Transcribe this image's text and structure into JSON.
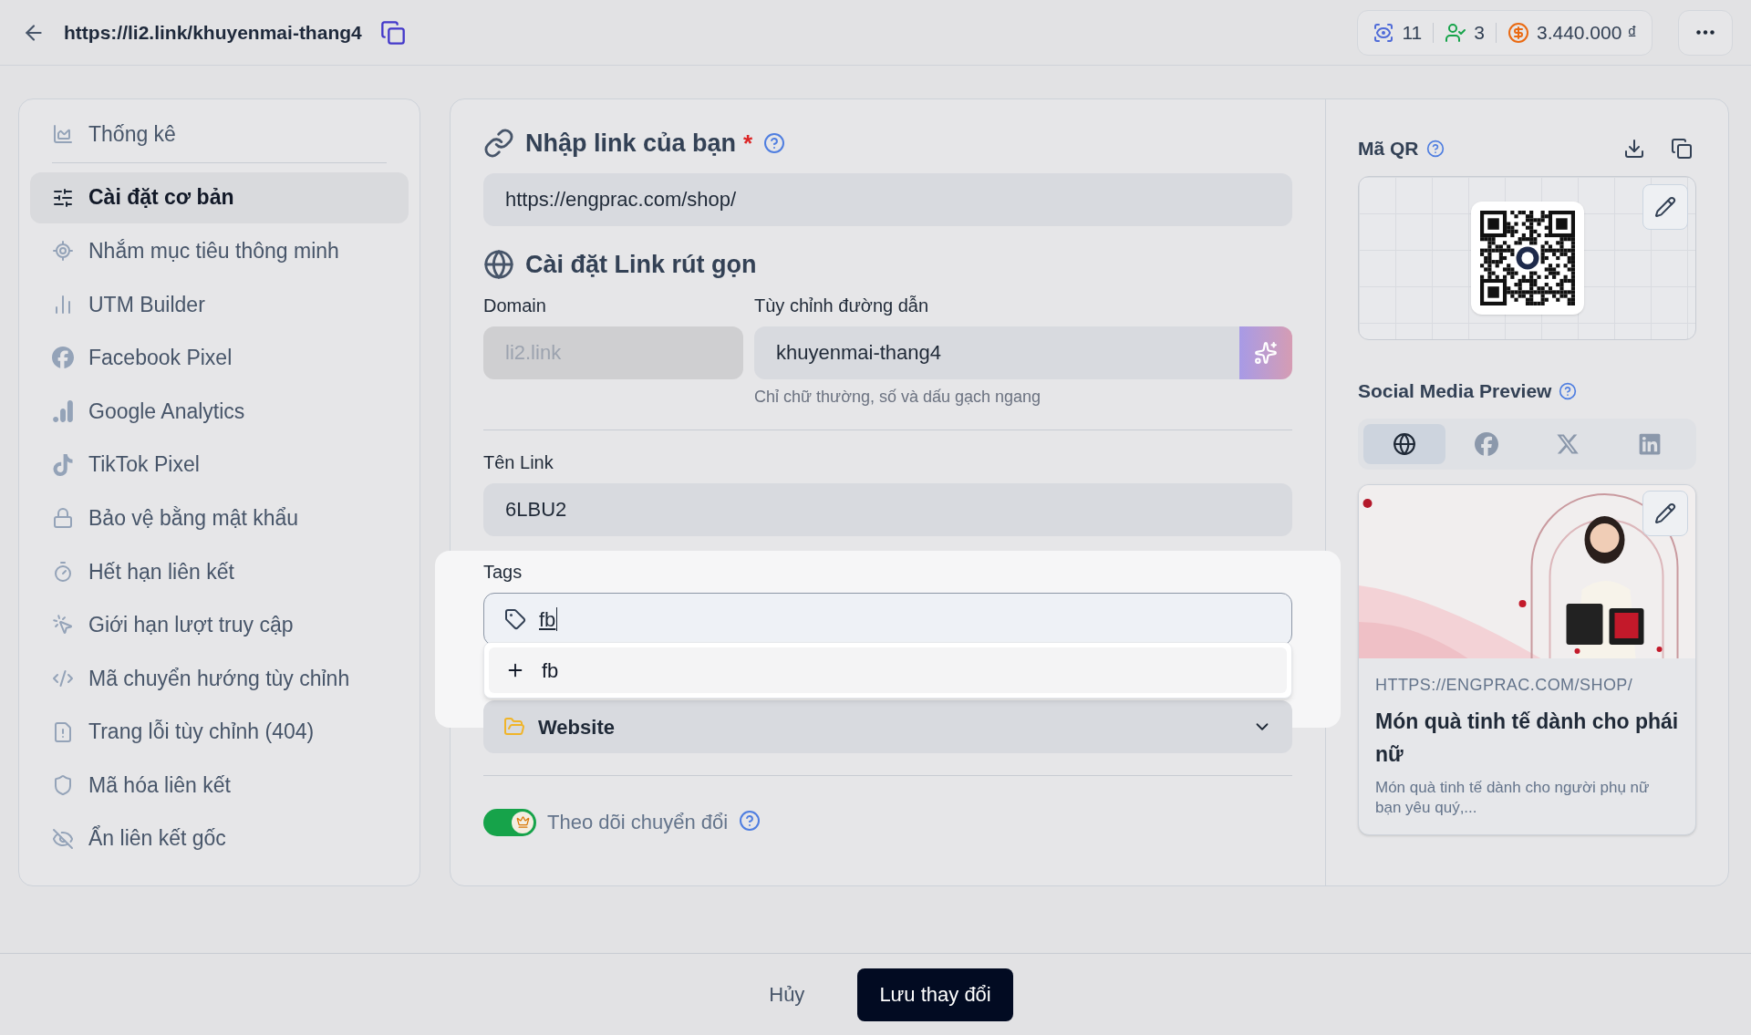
{
  "topbar": {
    "url": "https://li2.link/khuyenmai-thang4",
    "stats": [
      {
        "kind": "views",
        "value": "11"
      },
      {
        "kind": "users",
        "value": "3"
      },
      {
        "kind": "money",
        "value": "3.440.000 ₫"
      }
    ]
  },
  "sidebar": {
    "items": [
      {
        "label": "Thống kê",
        "kind": "chart",
        "selected": false
      },
      {
        "label": "Cài đặt cơ bản",
        "kind": "sliders",
        "selected": true
      },
      {
        "label": "Nhắm mục tiêu thông minh",
        "kind": "target",
        "selected": false
      },
      {
        "label": "UTM Builder",
        "kind": "bars",
        "selected": false
      },
      {
        "label": "Facebook Pixel",
        "kind": "facebook",
        "selected": false
      },
      {
        "label": "Google Analytics",
        "kind": "analytics",
        "selected": false
      },
      {
        "label": "TikTok Pixel",
        "kind": "tiktok",
        "selected": false
      },
      {
        "label": "Bảo vệ bằng mật khẩu",
        "kind": "lock",
        "selected": false
      },
      {
        "label": "Hết hạn liên kết",
        "kind": "timer",
        "selected": false
      },
      {
        "label": "Giới hạn lượt truy cập",
        "kind": "click",
        "selected": false
      },
      {
        "label": "Mã chuyển hướng tùy chỉnh",
        "kind": "code",
        "selected": false
      },
      {
        "label": "Trang lỗi tùy chỉnh (404)",
        "kind": "file",
        "selected": false
      },
      {
        "label": "Mã hóa liên kết",
        "kind": "shield",
        "selected": false
      },
      {
        "label": "Ẩn liên kết gốc",
        "kind": "eyeoff",
        "selected": false
      }
    ]
  },
  "link_section": {
    "title": "Nhập link của bạn",
    "required_mark": "*",
    "url": "https://engprac.com/shop/"
  },
  "short_link": {
    "title": "Cài đặt Link rút gọn",
    "domain_label": "Domain",
    "domain_value": "li2.link",
    "domain_disabled": true,
    "path_label": "Tùy chỉnh đường dẫn",
    "path_value": "khuyenmai-thang4",
    "hint": "Chỉ chữ thường, số và dấu gạch ngang"
  },
  "link_name": {
    "label": "Tên Link",
    "value": "6LBU2"
  },
  "tags": {
    "label": "Tags",
    "value": "fb",
    "suggestions": [
      "fb"
    ]
  },
  "folder": {
    "value": "Website"
  },
  "conversion": {
    "label": "Theo dõi chuyển đổi",
    "on": true
  },
  "qr": {
    "title": "Mã QR"
  },
  "social": {
    "title": "Social Media Preview",
    "tabs": [
      {
        "kind": "web",
        "selected": true
      },
      {
        "kind": "facebook",
        "selected": false
      },
      {
        "kind": "x",
        "selected": false
      },
      {
        "kind": "linkedin",
        "selected": false
      }
    ],
    "url": "HTTPS://ENGPRAC.COM/SHOP/",
    "headline": "Món quà tinh tế dành cho phái nữ",
    "description": "Món quà tinh tế dành cho người phụ nữ bạn yêu quý,..."
  },
  "footer": {
    "cancel": "Hủy",
    "save": "Lưu thay đổi"
  }
}
